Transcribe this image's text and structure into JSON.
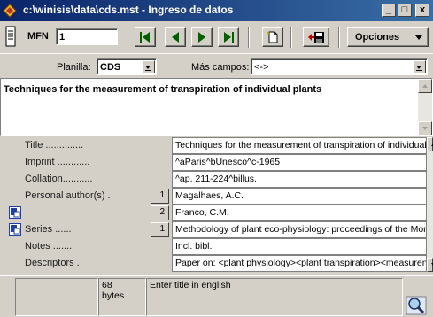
{
  "window": {
    "title": "c:\\winisis\\data\\cds.mst - Ingreso de datos",
    "minimize": "_",
    "restore": "□",
    "close": "x"
  },
  "toolbar": {
    "mfn_label": "MFN",
    "mfn_value": "1",
    "opciones_label": "Opciones"
  },
  "worksheet": {
    "planilla_label": "Planilla:",
    "planilla_value": "CDS",
    "mas_campos_label": "Más campos:",
    "mas_campos_value": "<->"
  },
  "editor": {
    "text": "Techniques for the measurement of transpiration of individual plants"
  },
  "fields": [
    {
      "label": "Title ..............",
      "occ": "",
      "value": "Techniques for the measurement of transpiration of individual p",
      "tag": false
    },
    {
      "label": "Imprint ............",
      "occ": "",
      "value": "^aParis^bUnesco^c-1965",
      "tag": false
    },
    {
      "label": "Collation...........",
      "occ": "",
      "value": "^ap. 211-224^billus.",
      "tag": false
    },
    {
      "label": "Personal author(s) .",
      "occ": "1",
      "value": "Magalhaes, A.C.",
      "tag": false
    },
    {
      "label": "",
      "occ": "2",
      "value": "Franco, C.M.",
      "tag": true
    },
    {
      "label": "Series ......",
      "occ": "1",
      "value": "Methodology of plant eco-physiology: proceedings of the Montp",
      "tag": true
    },
    {
      "label": "Notes .......",
      "occ": "",
      "value": "Incl. bibl.",
      "tag": false
    },
    {
      "label": "Descriptors .",
      "occ": "",
      "value": "Paper on: <plant physiology><plant transpiration><measuren",
      "tag": false
    }
  ],
  "status": {
    "size_line1": "68",
    "size_line2": "bytes",
    "hint": "Enter title in english"
  }
}
